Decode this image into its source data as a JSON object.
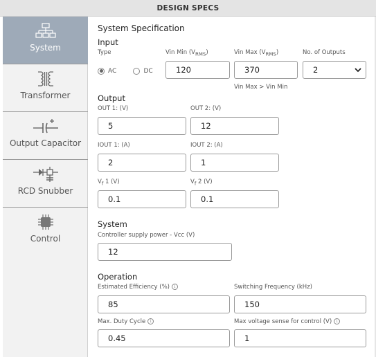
{
  "header": {
    "title": "DESIGN SPECS"
  },
  "sidebar": {
    "items": [
      {
        "label": "System",
        "icon": "system-icon",
        "active": true
      },
      {
        "label": "Transformer",
        "icon": "transformer-icon"
      },
      {
        "label": "Output Capacitor",
        "icon": "capacitor-icon"
      },
      {
        "label": "RCD Snubber",
        "icon": "snubber-icon"
      },
      {
        "label": "Control",
        "icon": "chip-icon"
      }
    ]
  },
  "spec": {
    "title": "System Specification",
    "input": {
      "heading": "Input",
      "type_label": "Type",
      "ac_label": "AC",
      "dc_label": "DC",
      "selected": "AC",
      "vin_min_label": "Vin Min (V",
      "vin_min_sub": "RMS",
      "vin_min_value": "120",
      "vin_max_label": "Vin Max (V",
      "vin_max_sub": "RMS",
      "vin_max_value": "370",
      "vin_hint": "Vin Max > Vin Min",
      "outputs_label": "No. of Outputs",
      "outputs_value": "2"
    },
    "output": {
      "heading": "Output",
      "out1_label": "OUT 1: (V)",
      "out1_value": "5",
      "out2_label": "OUT 2: (V)",
      "out2_value": "12",
      "iout1_label": "IOUT 1: (A)",
      "iout1_value": "2",
      "iout2_label": "IOUT 2: (A)",
      "iout2_value": "1",
      "vf1_label": "V",
      "vf1_sub": "f",
      "vf1_suffix": " 1 (V)",
      "vf1_value": "0.1",
      "vf2_label": "V",
      "vf2_sub": "f",
      "vf2_suffix": " 2 (V)",
      "vf2_value": "0.1"
    },
    "system": {
      "heading": "System",
      "vcc_label": "Controller supply power - Vcc (V)",
      "vcc_value": "12"
    },
    "operation": {
      "heading": "Operation",
      "eff_label": "Estimated Efficiency (%)",
      "eff_value": "85",
      "freq_label": "Switching Frequency (kHz)",
      "freq_value": "150",
      "duty_label": "Max. Duty Cycle",
      "duty_value": "0.45",
      "vsense_label": "Max voltage sense for control (V)",
      "vsense_value": "1"
    }
  },
  "colors": {
    "active_nav": "#9eaab8",
    "sidebar_bg": "#f2f2f2",
    "header_bg": "#e4e4e4"
  }
}
